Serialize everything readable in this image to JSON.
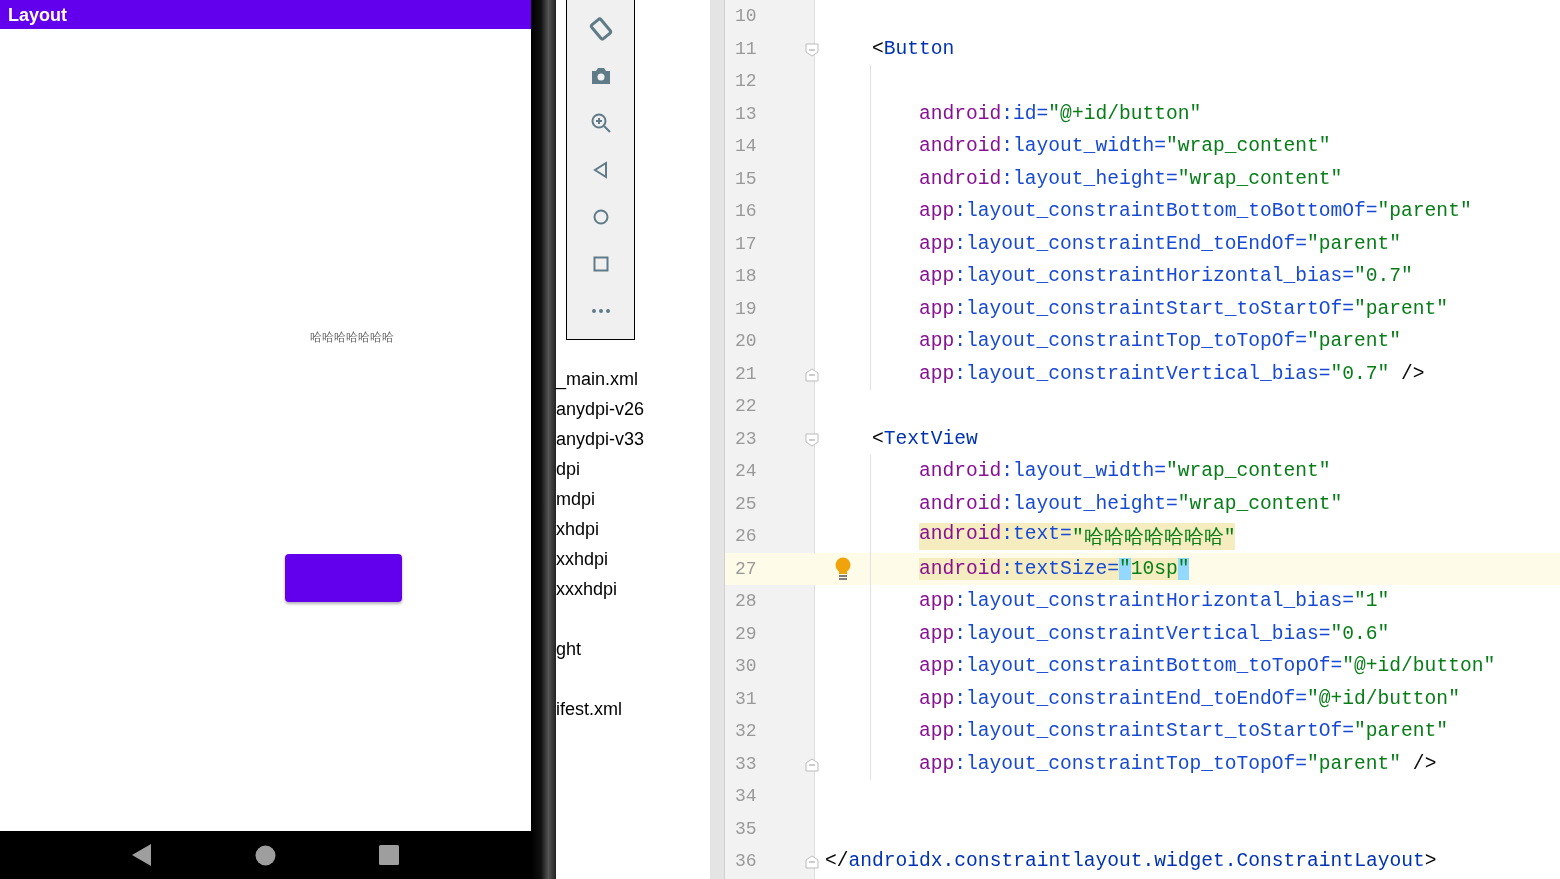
{
  "emulator": {
    "app_title": "Layout",
    "text_view": "哈哈哈哈哈哈哈",
    "toolbar": [
      {
        "kind": "rotate"
      },
      {
        "kind": "camera"
      },
      {
        "kind": "zoom"
      },
      {
        "kind": "back"
      },
      {
        "kind": "home"
      },
      {
        "kind": "overview"
      },
      {
        "kind": "more"
      }
    ]
  },
  "project_tree": {
    "items": [
      "_main.xml",
      "anydpi-v26",
      "anydpi-v33",
      "dpi",
      "mdpi",
      "xhdpi",
      "xxhdpi",
      "xxxhdpi",
      "ght",
      "ifest.xml"
    ]
  },
  "editor": {
    "lines": [
      {
        "number": "10",
        "kind": "blank"
      },
      {
        "number": "11",
        "kind": "element",
        "fold_open": true,
        "tokens": [
          {
            "kind": "punct",
            "text": "<"
          },
          {
            "kind": "tag",
            "text": "Button"
          }
        ]
      },
      {
        "number": "12",
        "kind": "blank"
      },
      {
        "number": "13",
        "kind": "attribute",
        "tokens": [
          {
            "kind": "ns",
            "text": "android"
          },
          {
            "kind": "attr",
            "text": ":id="
          },
          {
            "kind": "str",
            "text": "\"@+id/button\""
          }
        ]
      },
      {
        "number": "14",
        "kind": "attribute",
        "tokens": [
          {
            "kind": "ns",
            "text": "android"
          },
          {
            "kind": "attr",
            "text": ":layout_width="
          },
          {
            "kind": "str",
            "text": "\"wrap_content\""
          }
        ]
      },
      {
        "number": "15",
        "kind": "attribute",
        "tokens": [
          {
            "kind": "ns",
            "text": "android"
          },
          {
            "kind": "attr",
            "text": ":layout_height="
          },
          {
            "kind": "str",
            "text": "\"wrap_content\""
          }
        ]
      },
      {
        "number": "16",
        "kind": "attribute",
        "tokens": [
          {
            "kind": "ns",
            "text": "app"
          },
          {
            "kind": "attr",
            "text": ":layout_constraintBottom_toBottomOf="
          },
          {
            "kind": "str",
            "text": "\"parent\""
          }
        ]
      },
      {
        "number": "17",
        "kind": "attribute",
        "tokens": [
          {
            "kind": "ns",
            "text": "app"
          },
          {
            "kind": "attr",
            "text": ":layout_constraintEnd_toEndOf="
          },
          {
            "kind": "str",
            "text": "\"parent\""
          }
        ]
      },
      {
        "number": "18",
        "kind": "attribute",
        "tokens": [
          {
            "kind": "ns",
            "text": "app"
          },
          {
            "kind": "attr",
            "text": ":layout_constraintHorizontal_bias="
          },
          {
            "kind": "str",
            "text": "\"0.7\""
          }
        ]
      },
      {
        "number": "19",
        "kind": "attribute",
        "tokens": [
          {
            "kind": "ns",
            "text": "app"
          },
          {
            "kind": "attr",
            "text": ":layout_constraintStart_toStartOf="
          },
          {
            "kind": "str",
            "text": "\"parent\""
          }
        ]
      },
      {
        "number": "20",
        "kind": "attribute",
        "tokens": [
          {
            "kind": "ns",
            "text": "app"
          },
          {
            "kind": "attr",
            "text": ":layout_constraintTop_toTopOf="
          },
          {
            "kind": "str",
            "text": "\"parent\""
          }
        ]
      },
      {
        "number": "21",
        "kind": "attribute",
        "fold_close": true,
        "tokens": [
          {
            "kind": "ns",
            "text": "app"
          },
          {
            "kind": "attr",
            "text": ":layout_constraintVertical_bias="
          },
          {
            "kind": "str",
            "text": "\"0.7\""
          },
          {
            "kind": "punct",
            "text": " />"
          }
        ]
      },
      {
        "number": "22",
        "kind": "blank"
      },
      {
        "number": "23",
        "kind": "element",
        "fold_open": true,
        "tokens": [
          {
            "kind": "punct",
            "text": "<"
          },
          {
            "kind": "tag",
            "text": "TextView"
          }
        ]
      },
      {
        "number": "24",
        "kind": "attribute",
        "tokens": [
          {
            "kind": "ns",
            "text": "android"
          },
          {
            "kind": "attr",
            "text": ":layout_width="
          },
          {
            "kind": "str",
            "text": "\"wrap_content\""
          }
        ]
      },
      {
        "number": "25",
        "kind": "attribute",
        "tokens": [
          {
            "kind": "ns",
            "text": "android"
          },
          {
            "kind": "attr",
            "text": ":layout_height="
          },
          {
            "kind": "str",
            "text": "\"wrap_content\""
          }
        ]
      },
      {
        "number": "26",
        "kind": "attribute",
        "warning": true,
        "tokens": [
          {
            "kind": "ns",
            "text": "android"
          },
          {
            "kind": "attr",
            "text": ":text="
          },
          {
            "kind": "str",
            "text": "\"哈哈哈哈哈哈哈\""
          }
        ]
      },
      {
        "number": "27",
        "kind": "attribute",
        "warning": true,
        "current": true,
        "bulb": true,
        "tokens": [
          {
            "kind": "ns",
            "text": "android"
          },
          {
            "kind": "attr",
            "text": ":textSize="
          },
          {
            "kind": "match",
            "text": "\""
          },
          {
            "kind": "str",
            "text": "10sp"
          },
          {
            "kind": "match",
            "text": "\""
          }
        ]
      },
      {
        "number": "28",
        "kind": "attribute",
        "tokens": [
          {
            "kind": "ns",
            "text": "app"
          },
          {
            "kind": "attr",
            "text": ":layout_constraintHorizontal_bias="
          },
          {
            "kind": "str",
            "text": "\"1\""
          }
        ]
      },
      {
        "number": "29",
        "kind": "attribute",
        "tokens": [
          {
            "kind": "ns",
            "text": "app"
          },
          {
            "kind": "attr",
            "text": ":layout_constraintVertical_bias="
          },
          {
            "kind": "str",
            "text": "\"0.6\""
          }
        ]
      },
      {
        "number": "30",
        "kind": "attribute",
        "tokens": [
          {
            "kind": "ns",
            "text": "app"
          },
          {
            "kind": "attr",
            "text": ":layout_constraintBottom_toTopOf="
          },
          {
            "kind": "str",
            "text": "\"@+id/button\""
          }
        ]
      },
      {
        "number": "31",
        "kind": "attribute",
        "tokens": [
          {
            "kind": "ns",
            "text": "app"
          },
          {
            "kind": "attr",
            "text": ":layout_constraintEnd_toEndOf="
          },
          {
            "kind": "str",
            "text": "\"@+id/button\""
          }
        ]
      },
      {
        "number": "32",
        "kind": "attribute",
        "tokens": [
          {
            "kind": "ns",
            "text": "app"
          },
          {
            "kind": "attr",
            "text": ":layout_constraintStart_toStartOf="
          },
          {
            "kind": "str",
            "text": "\"parent\""
          }
        ]
      },
      {
        "number": "33",
        "kind": "attribute",
        "fold_close": true,
        "tokens": [
          {
            "kind": "ns",
            "text": "app"
          },
          {
            "kind": "attr",
            "text": ":layout_constraintTop_toTopOf="
          },
          {
            "kind": "str",
            "text": "\"parent\""
          },
          {
            "kind": "punct",
            "text": " />"
          }
        ]
      },
      {
        "number": "34",
        "kind": "blank"
      },
      {
        "number": "35",
        "kind": "blank"
      },
      {
        "number": "36",
        "kind": "root",
        "fold_close": true,
        "tokens": [
          {
            "kind": "punct",
            "text": "</"
          },
          {
            "kind": "tag",
            "text": "androidx.constraintlayout.widget.ConstraintLayout"
          },
          {
            "kind": "punct",
            "text": ">"
          }
        ]
      }
    ]
  }
}
